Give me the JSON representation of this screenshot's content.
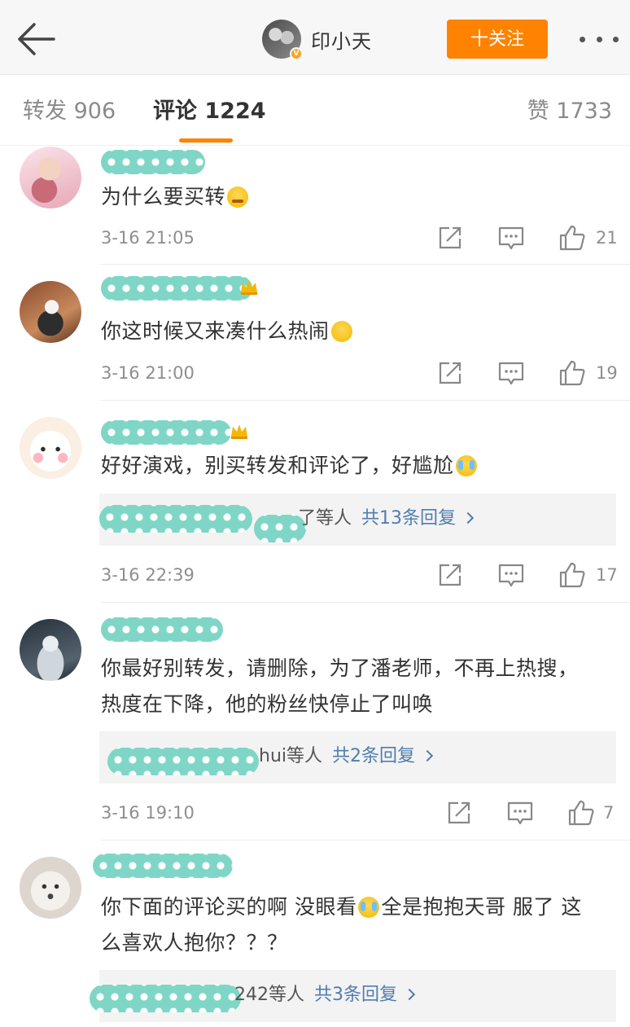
{
  "header": {
    "username": "印小天",
    "verified_badge": "V",
    "follow_label": "十关注",
    "back_icon": "back-arrow-icon",
    "more_icon": "more-dots-icon"
  },
  "tabs": {
    "repost": "转发 906",
    "comment": "评论 1224",
    "like": "赞 1733"
  },
  "colors": {
    "accent": "#ff8200",
    "link": "#507daf",
    "redaction": "#7fd6c6"
  },
  "comments": [
    {
      "text": "为什么要买转",
      "emoji": "sad-emoji-icon",
      "time": "3-16 21:05",
      "likes": "21"
    },
    {
      "text": "你这时候又来凑什么热闹",
      "emoji": "smirk-emoji-icon",
      "time": "3-16 21:00",
      "likes": "19"
    },
    {
      "text": "好好演戏，别买转发和评论了，好尴尬",
      "emoji": "cry-laugh-emoji-icon",
      "reply_visible": "了等人",
      "reply_link": "共13条回复",
      "time": "3-16 22:39",
      "likes": "17"
    },
    {
      "text": "你最好别转发，请删除，为了潘老师，不再上热搜，热度在下降，他的粉丝快停止了叫唤",
      "reply_visible": "hui等人",
      "reply_link": "共2条回复",
      "time": "3-16 19:10",
      "likes": "7"
    },
    {
      "text_a": "你下面的评论买的啊 没眼看",
      "emoji": "cry-laugh-emoji-icon",
      "text_b": "全是抱抱天哥 服了 这么喜欢人抱你？？？",
      "reply_visible": "242等人",
      "reply_link": "共3条回复"
    }
  ]
}
